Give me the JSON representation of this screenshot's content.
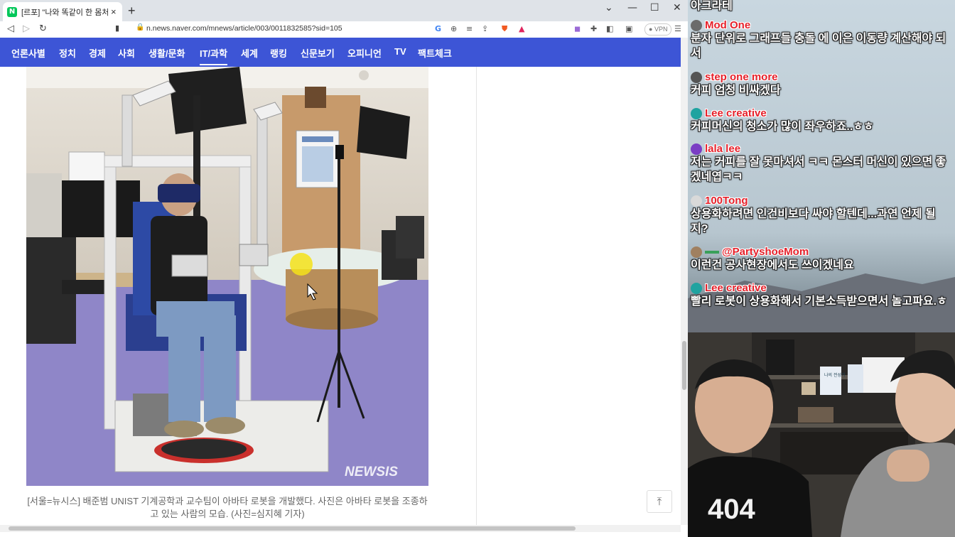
{
  "browser": {
    "tab_title": "[르포] \"나와 똑같이 한 몸처럼 움직",
    "tab_close": "×",
    "new_tab": "+",
    "win_controls": [
      "⌄",
      "—",
      "☐",
      "✕"
    ],
    "url": "n.news.naver.com/mnews/article/003/0011832585?sid=105",
    "vpn_label": "VPN",
    "favicon_letter": "N"
  },
  "naver_nav": {
    "items": [
      "언론사별",
      "정치",
      "경제",
      "사회",
      "생활/문화",
      "IT/과학",
      "세계",
      "랭킹",
      "신문보기",
      "오피니언",
      "TV",
      "팩트체크"
    ],
    "active": "IT/과학"
  },
  "article": {
    "photo_watermark": "NEWSIS",
    "caption_line1": "[서울=뉴시스] 배준범 UNIST 기계공학과 교수팀이 아바타 로봇을 개발했다. 사진은 아바타 로봇을 조종하",
    "caption_line2": "고 있는 사람의 모습. (사진=심지혜 기자)",
    "to_top_icon": "⤒"
  },
  "chat": {
    "messages": [
      {
        "name": "",
        "text": "아크라테",
        "color": "#e6202a",
        "avatar": "#888888"
      },
      {
        "name": "Mod One",
        "text": "분자 단위로 그래프들 충돌 에 이은 이동량 계산해야 되서",
        "color": "#e6202a",
        "avatar": "#6b6b6b"
      },
      {
        "name": "step one more",
        "text": "커피 엄청 비싸겠다",
        "color": "#e6202a",
        "avatar": "#555555"
      },
      {
        "name": "Lee creative",
        "text": "커피머신의 청소가 많이 좌우하죠..ㅎㅎ",
        "color": "#e6202a",
        "avatar": "#1fa3a0"
      },
      {
        "name": "lala lee",
        "text": "저는 커피를 잘 못마셔서 ㅋㅋ 몬스터 머신이 있으면 좋겠네엽ㅋㅋ",
        "color": "#e6202a",
        "avatar": "#7a3dc4"
      },
      {
        "name": "100Tong",
        "text": "상용화하려면 인건비보다 싸야 할텐데...과연 언제 될지?",
        "color": "#e6202a",
        "avatar": "#d9d9d9"
      },
      {
        "name": "@PartyshoeMom",
        "text": "이런건 공사현장에서도 쓰이겠네요",
        "color": "#e6202a",
        "avatar": "#a08060"
      },
      {
        "name": "Lee creative",
        "text": "빨리 로봇이 상용화해서 기본소득받으면서 놀고파요.ㅎ",
        "color": "#e6202a",
        "avatar": "#1fa3a0"
      }
    ]
  },
  "webcam": {
    "shirt_text": "404",
    "book_label": "나의 전성기"
  }
}
